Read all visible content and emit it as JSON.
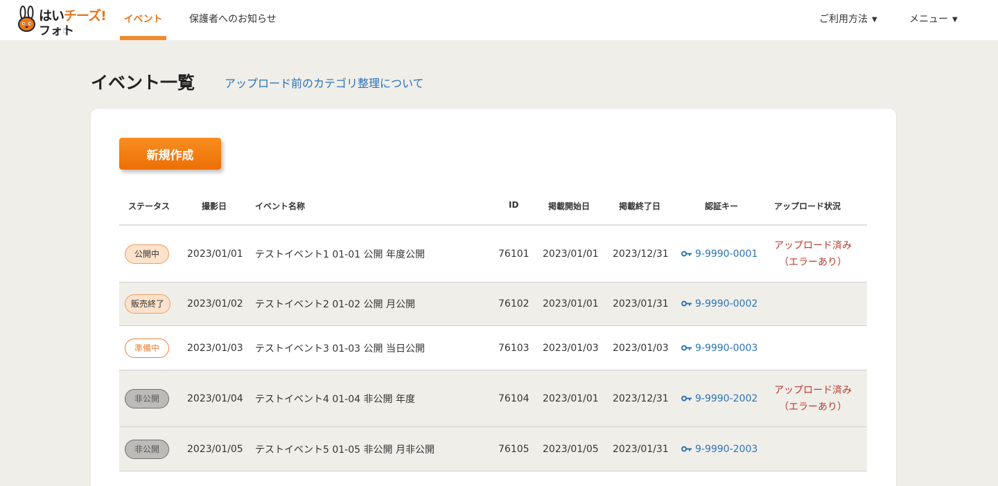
{
  "header": {
    "logo": {
      "line1_a": "はい",
      "line1_b": "チーズ!",
      "line2": "フォト"
    },
    "nav": [
      {
        "label": "イベント",
        "active": true
      },
      {
        "label": "保護者へのお知らせ",
        "active": false
      }
    ],
    "menus": [
      {
        "label": "ご利用方法"
      },
      {
        "label": "メニュー"
      }
    ]
  },
  "page": {
    "title": "イベント一覧",
    "category_link": "アップロード前のカテゴリ整理について",
    "new_button": "新規作成"
  },
  "table": {
    "columns": [
      "ステータス",
      "撮影日",
      "イベント名称",
      "ID",
      "掲載開始日",
      "掲載終了日",
      "認証キー",
      "アップロード状況"
    ],
    "rows": [
      {
        "status": "公開中",
        "status_type": "open",
        "shoot_date": "2023/01/01",
        "name": "テストイベント1 01-01 公開 年度公開",
        "id": "76101",
        "start": "2023/01/01",
        "end": "2023/12/31",
        "key": "9-9990-0001",
        "upload_line1": "アップロード済み",
        "upload_line2": "（エラーあり）"
      },
      {
        "status": "販売終了",
        "status_type": "ended",
        "shoot_date": "2023/01/02",
        "name": "テストイベント2 01-02 公開 月公開",
        "id": "76102",
        "start": "2023/01/01",
        "end": "2023/01/31",
        "key": "9-9990-0002",
        "upload_line1": "",
        "upload_line2": ""
      },
      {
        "status": "準備中",
        "status_type": "prep",
        "shoot_date": "2023/01/03",
        "name": "テストイベント3 01-03 公開 当日公開",
        "id": "76103",
        "start": "2023/01/03",
        "end": "2023/01/03",
        "key": "9-9990-0003",
        "upload_line1": "",
        "upload_line2": ""
      },
      {
        "status": "非公開",
        "status_type": "private",
        "shoot_date": "2023/01/04",
        "name": "テストイベント4 01-04 非公開 年度",
        "id": "76104",
        "start": "2023/01/01",
        "end": "2023/12/31",
        "key": "9-9990-2002",
        "upload_line1": "アップロード済み",
        "upload_line2": "（エラーあり）"
      },
      {
        "status": "非公開",
        "status_type": "private",
        "shoot_date": "2023/01/05",
        "name": "テストイベント5 01-05 非公開 月非公開",
        "id": "76105",
        "start": "2023/01/05",
        "end": "2023/01/31",
        "key": "9-9990-2003",
        "upload_line1": "",
        "upload_line2": ""
      }
    ]
  },
  "colors": {
    "accent": "#e8771e",
    "link": "#2a73b8",
    "error": "#b53b30",
    "background": "#f0eee9"
  },
  "icons": {
    "logo": "rabbit-mascot-icon",
    "cursor": "hand-pointer-icon",
    "dropdown": "caret-down-icon",
    "auth_key": "key-icon"
  }
}
